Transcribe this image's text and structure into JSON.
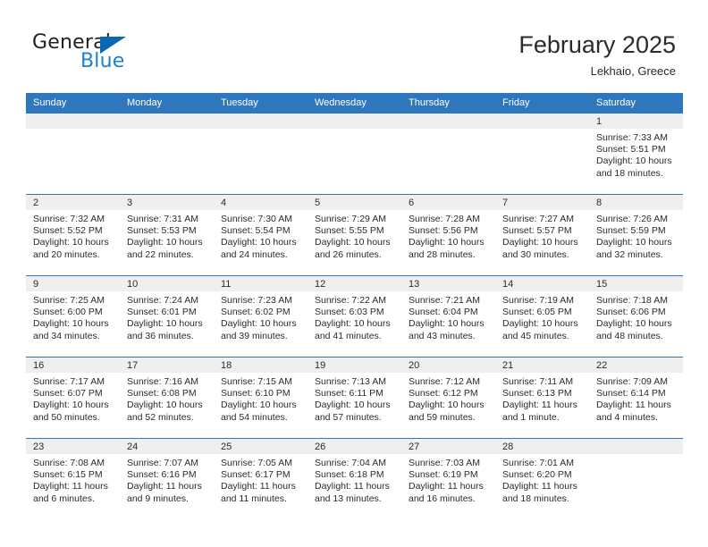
{
  "brand": {
    "name_top": "General",
    "name_bottom": "Blue",
    "triangle_color": "#0a67b1",
    "text_color_top": "#231f20",
    "text_color_bottom": "#1a81d6"
  },
  "header": {
    "title": "February 2025",
    "location": "Lekhaio, Greece"
  },
  "theme": {
    "header_bg": "#2f77bc",
    "header_text": "#ffffff",
    "daynum_band_bg": "#efefef",
    "cell_bg": "#ffffff",
    "body_text": "#2b2b2b",
    "row_border": "#2f77bc"
  },
  "calendar": {
    "weekday_headers": [
      "Sunday",
      "Monday",
      "Tuesday",
      "Wednesday",
      "Thursday",
      "Friday",
      "Saturday"
    ],
    "labels": {
      "sunrise": "Sunrise:",
      "sunset": "Sunset:",
      "daylight": "Daylight:"
    },
    "weeks": [
      [
        {
          "day": "",
          "empty": true
        },
        {
          "day": "",
          "empty": true
        },
        {
          "day": "",
          "empty": true
        },
        {
          "day": "",
          "empty": true
        },
        {
          "day": "",
          "empty": true
        },
        {
          "day": "",
          "empty": true
        },
        {
          "day": "1",
          "sunrise": "Sunrise: 7:33 AM",
          "sunset": "Sunset: 5:51 PM",
          "daylight_1": "Daylight: 10 hours",
          "daylight_2": "and 18 minutes."
        }
      ],
      [
        {
          "day": "2",
          "sunrise": "Sunrise: 7:32 AM",
          "sunset": "Sunset: 5:52 PM",
          "daylight_1": "Daylight: 10 hours",
          "daylight_2": "and 20 minutes."
        },
        {
          "day": "3",
          "sunrise": "Sunrise: 7:31 AM",
          "sunset": "Sunset: 5:53 PM",
          "daylight_1": "Daylight: 10 hours",
          "daylight_2": "and 22 minutes."
        },
        {
          "day": "4",
          "sunrise": "Sunrise: 7:30 AM",
          "sunset": "Sunset: 5:54 PM",
          "daylight_1": "Daylight: 10 hours",
          "daylight_2": "and 24 minutes."
        },
        {
          "day": "5",
          "sunrise": "Sunrise: 7:29 AM",
          "sunset": "Sunset: 5:55 PM",
          "daylight_1": "Daylight: 10 hours",
          "daylight_2": "and 26 minutes."
        },
        {
          "day": "6",
          "sunrise": "Sunrise: 7:28 AM",
          "sunset": "Sunset: 5:56 PM",
          "daylight_1": "Daylight: 10 hours",
          "daylight_2": "and 28 minutes."
        },
        {
          "day": "7",
          "sunrise": "Sunrise: 7:27 AM",
          "sunset": "Sunset: 5:57 PM",
          "daylight_1": "Daylight: 10 hours",
          "daylight_2": "and 30 minutes."
        },
        {
          "day": "8",
          "sunrise": "Sunrise: 7:26 AM",
          "sunset": "Sunset: 5:59 PM",
          "daylight_1": "Daylight: 10 hours",
          "daylight_2": "and 32 minutes."
        }
      ],
      [
        {
          "day": "9",
          "sunrise": "Sunrise: 7:25 AM",
          "sunset": "Sunset: 6:00 PM",
          "daylight_1": "Daylight: 10 hours",
          "daylight_2": "and 34 minutes."
        },
        {
          "day": "10",
          "sunrise": "Sunrise: 7:24 AM",
          "sunset": "Sunset: 6:01 PM",
          "daylight_1": "Daylight: 10 hours",
          "daylight_2": "and 36 minutes."
        },
        {
          "day": "11",
          "sunrise": "Sunrise: 7:23 AM",
          "sunset": "Sunset: 6:02 PM",
          "daylight_1": "Daylight: 10 hours",
          "daylight_2": "and 39 minutes."
        },
        {
          "day": "12",
          "sunrise": "Sunrise: 7:22 AM",
          "sunset": "Sunset: 6:03 PM",
          "daylight_1": "Daylight: 10 hours",
          "daylight_2": "and 41 minutes."
        },
        {
          "day": "13",
          "sunrise": "Sunrise: 7:21 AM",
          "sunset": "Sunset: 6:04 PM",
          "daylight_1": "Daylight: 10 hours",
          "daylight_2": "and 43 minutes."
        },
        {
          "day": "14",
          "sunrise": "Sunrise: 7:19 AM",
          "sunset": "Sunset: 6:05 PM",
          "daylight_1": "Daylight: 10 hours",
          "daylight_2": "and 45 minutes."
        },
        {
          "day": "15",
          "sunrise": "Sunrise: 7:18 AM",
          "sunset": "Sunset: 6:06 PM",
          "daylight_1": "Daylight: 10 hours",
          "daylight_2": "and 48 minutes."
        }
      ],
      [
        {
          "day": "16",
          "sunrise": "Sunrise: 7:17 AM",
          "sunset": "Sunset: 6:07 PM",
          "daylight_1": "Daylight: 10 hours",
          "daylight_2": "and 50 minutes."
        },
        {
          "day": "17",
          "sunrise": "Sunrise: 7:16 AM",
          "sunset": "Sunset: 6:08 PM",
          "daylight_1": "Daylight: 10 hours",
          "daylight_2": "and 52 minutes."
        },
        {
          "day": "18",
          "sunrise": "Sunrise: 7:15 AM",
          "sunset": "Sunset: 6:10 PM",
          "daylight_1": "Daylight: 10 hours",
          "daylight_2": "and 54 minutes."
        },
        {
          "day": "19",
          "sunrise": "Sunrise: 7:13 AM",
          "sunset": "Sunset: 6:11 PM",
          "daylight_1": "Daylight: 10 hours",
          "daylight_2": "and 57 minutes."
        },
        {
          "day": "20",
          "sunrise": "Sunrise: 7:12 AM",
          "sunset": "Sunset: 6:12 PM",
          "daylight_1": "Daylight: 10 hours",
          "daylight_2": "and 59 minutes."
        },
        {
          "day": "21",
          "sunrise": "Sunrise: 7:11 AM",
          "sunset": "Sunset: 6:13 PM",
          "daylight_1": "Daylight: 11 hours",
          "daylight_2": "and 1 minute."
        },
        {
          "day": "22",
          "sunrise": "Sunrise: 7:09 AM",
          "sunset": "Sunset: 6:14 PM",
          "daylight_1": "Daylight: 11 hours",
          "daylight_2": "and 4 minutes."
        }
      ],
      [
        {
          "day": "23",
          "sunrise": "Sunrise: 7:08 AM",
          "sunset": "Sunset: 6:15 PM",
          "daylight_1": "Daylight: 11 hours",
          "daylight_2": "and 6 minutes."
        },
        {
          "day": "24",
          "sunrise": "Sunrise: 7:07 AM",
          "sunset": "Sunset: 6:16 PM",
          "daylight_1": "Daylight: 11 hours",
          "daylight_2": "and 9 minutes."
        },
        {
          "day": "25",
          "sunrise": "Sunrise: 7:05 AM",
          "sunset": "Sunset: 6:17 PM",
          "daylight_1": "Daylight: 11 hours",
          "daylight_2": "and 11 minutes."
        },
        {
          "day": "26",
          "sunrise": "Sunrise: 7:04 AM",
          "sunset": "Sunset: 6:18 PM",
          "daylight_1": "Daylight: 11 hours",
          "daylight_2": "and 13 minutes."
        },
        {
          "day": "27",
          "sunrise": "Sunrise: 7:03 AM",
          "sunset": "Sunset: 6:19 PM",
          "daylight_1": "Daylight: 11 hours",
          "daylight_2": "and 16 minutes."
        },
        {
          "day": "28",
          "sunrise": "Sunrise: 7:01 AM",
          "sunset": "Sunset: 6:20 PM",
          "daylight_1": "Daylight: 11 hours",
          "daylight_2": "and 18 minutes."
        },
        {
          "day": "",
          "empty": true
        }
      ]
    ]
  }
}
